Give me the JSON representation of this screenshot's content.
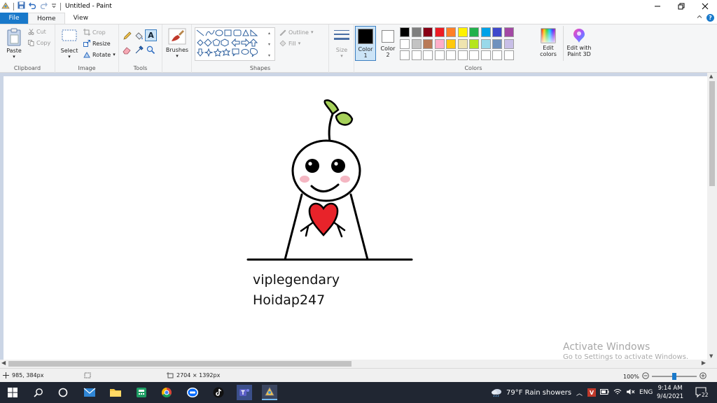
{
  "window": {
    "title": "Untitled - Paint"
  },
  "tabs": [
    {
      "label": "File"
    },
    {
      "label": "Home"
    },
    {
      "label": "View"
    }
  ],
  "clipboard": {
    "paste": "Paste",
    "cut": "Cut",
    "copy": "Copy",
    "label": "Clipboard"
  },
  "image": {
    "select": "Select",
    "crop": "Crop",
    "resize": "Resize",
    "rotate": "Rotate",
    "label": "Image"
  },
  "tools": {
    "label": "Tools"
  },
  "brushes": {
    "label": "Brushes"
  },
  "shapes": {
    "outline": "Outline",
    "fill": "Fill",
    "label": "Shapes"
  },
  "size": {
    "label": "Size"
  },
  "colors": {
    "color1_label": "Color",
    "color1_num": "1",
    "color2_label": "Color",
    "color2_num": "2",
    "edit_colors_l1": "Edit",
    "edit_colors_l2": "colors",
    "paint3d_l1": "Edit with",
    "paint3d_l2": "Paint 3D",
    "label": "Colors",
    "color1": "#000000",
    "color2": "#ffffff",
    "palette_row1": [
      "#000000",
      "#7f7f7f",
      "#880015",
      "#ed1c24",
      "#ff7f27",
      "#fff200",
      "#22b14c",
      "#00a2e8",
      "#3f48cc",
      "#a349a4"
    ],
    "palette_row2": [
      "#ffffff",
      "#c3c3c3",
      "#b97a57",
      "#ffaec9",
      "#ffc90e",
      "#efe4b0",
      "#b5e61d",
      "#99d9ea",
      "#7092be",
      "#c8bfe7"
    ]
  },
  "canvas": {
    "text_line1": "viplegendary",
    "text_line2": "Hoidap247"
  },
  "watermark": {
    "line1": "Activate Windows",
    "line2": "Go to Settings to activate Windows."
  },
  "status": {
    "cursor_pos": "985, 384px",
    "canvas_size": "2704 × 1392px",
    "zoom": "100%",
    "zoom_fraction": 0.5
  },
  "taskbar": {
    "weather": "79°F  Rain showers",
    "lang": "ENG",
    "time": "9:14 AM",
    "date": "9/4/2021",
    "notifications": "22",
    "vpn_badge": "V"
  }
}
